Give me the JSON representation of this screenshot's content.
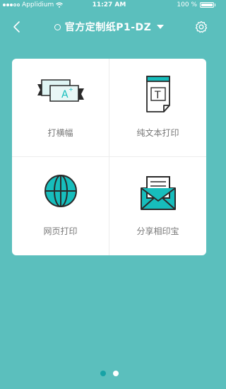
{
  "status_bar": {
    "carrier": "Applidium",
    "time": "11:27 AM",
    "battery": "100 %"
  },
  "nav": {
    "title": "官方定制纸P1-DZ",
    "back_icon": "chevron-left-icon",
    "settings_icon": "gear-icon"
  },
  "features": [
    {
      "label": "打横幅",
      "icon": "banner-icon"
    },
    {
      "label": "纯文本打印",
      "icon": "text-document-icon"
    },
    {
      "label": "网页打印",
      "icon": "globe-icon"
    },
    {
      "label": "分享相印宝",
      "icon": "envelope-icon"
    }
  ],
  "pager": {
    "count": 2,
    "active": 0
  },
  "colors": {
    "background": "#5bbfbd",
    "accent": "#17bdbc",
    "card": "#ffffff",
    "label": "#777777"
  }
}
